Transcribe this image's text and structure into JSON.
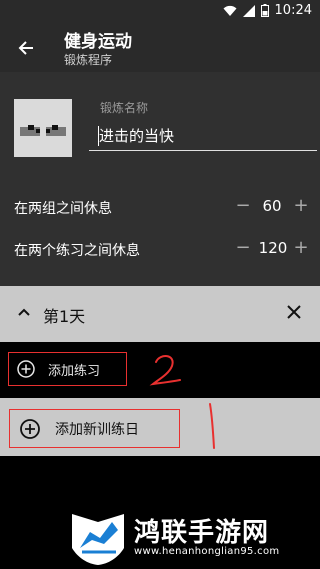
{
  "status": {
    "time": "10:24"
  },
  "appbar": {
    "title": "健身运动",
    "subtitle": "锻炼程序"
  },
  "form": {
    "name_label": "锻炼名称",
    "name_value": "进击的当快",
    "rest_between_sets": {
      "label": "在两组之间休息",
      "value": "60",
      "minus": "−",
      "plus": "+"
    },
    "rest_between_exercises": {
      "label": "在两个练习之间休息",
      "value": "120",
      "minus": "−",
      "plus": "+"
    }
  },
  "day": {
    "label": "第1天"
  },
  "actions": {
    "add_exercise": "添加练习",
    "add_training_day": "添加新训练日"
  },
  "annotations": {
    "handwritten_2": "2",
    "handwritten_1": "1"
  },
  "watermark": {
    "name": "鸿联手游网",
    "url": "www.henanhonglian95.com"
  },
  "colors": {
    "annotation": "#e8302f",
    "app_bar": "#2a2a2a",
    "header_gray": "#c9c9c9"
  }
}
